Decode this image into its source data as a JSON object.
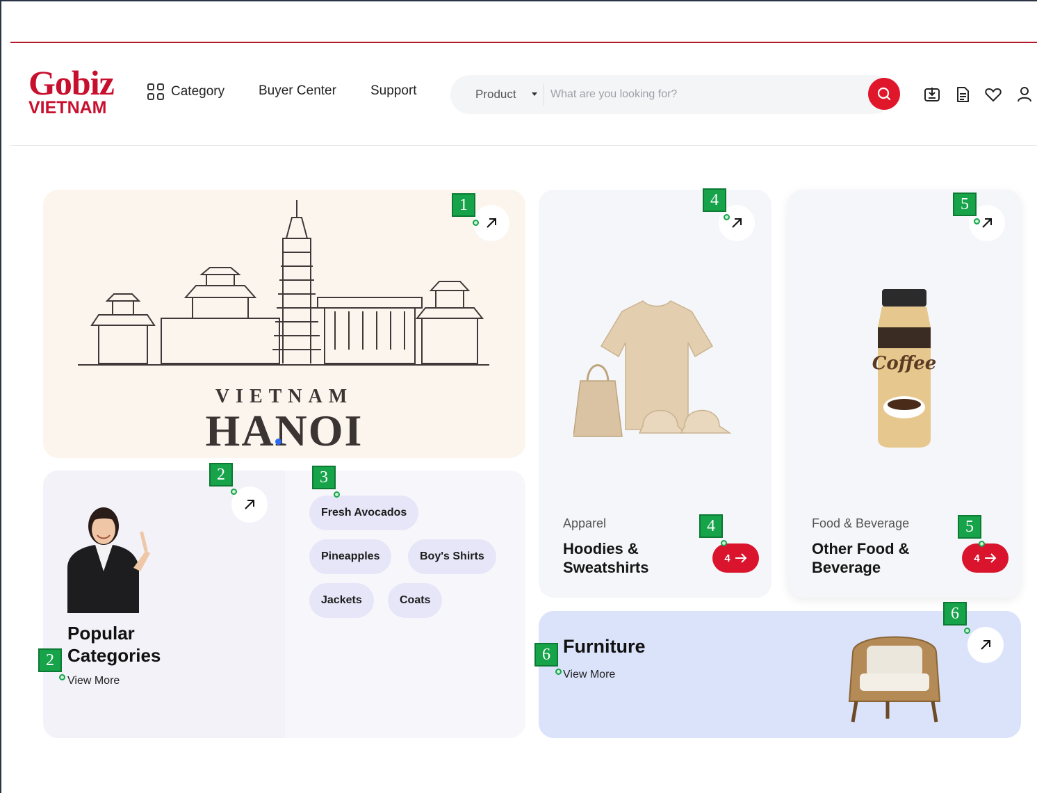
{
  "brand": {
    "logo_line1": "Gobiz",
    "logo_line2": "VIETNAM",
    "accent_color": "#c8102e"
  },
  "nav": {
    "category": "Category",
    "buyer_center": "Buyer Center",
    "support": "Support"
  },
  "search": {
    "category": "Product",
    "placeholder": "What are you looking for?"
  },
  "header_icons": [
    "download-box-icon",
    "document-icon",
    "heart-icon",
    "user-icon"
  ],
  "hanoi_banner": {
    "subtitle": "VIETNAM",
    "title": "HANOI"
  },
  "popular": {
    "title": "Popular Categories",
    "view_more": "View More",
    "chips": [
      "Fresh Avocados",
      "Pineapples",
      "Boy's Shirts",
      "Jackets",
      "Coats"
    ]
  },
  "apparel": {
    "label": "Apparel",
    "name": "Hoodies & Sweatshirts",
    "count": "4"
  },
  "food": {
    "label": "Food & Beverage",
    "name": "Other Food & Beverage",
    "count": "4"
  },
  "furniture": {
    "title": "Furniture",
    "view_more": "View More"
  },
  "markers": [
    "1",
    "2",
    "2",
    "3",
    "4",
    "4",
    "5",
    "5",
    "6",
    "6"
  ]
}
